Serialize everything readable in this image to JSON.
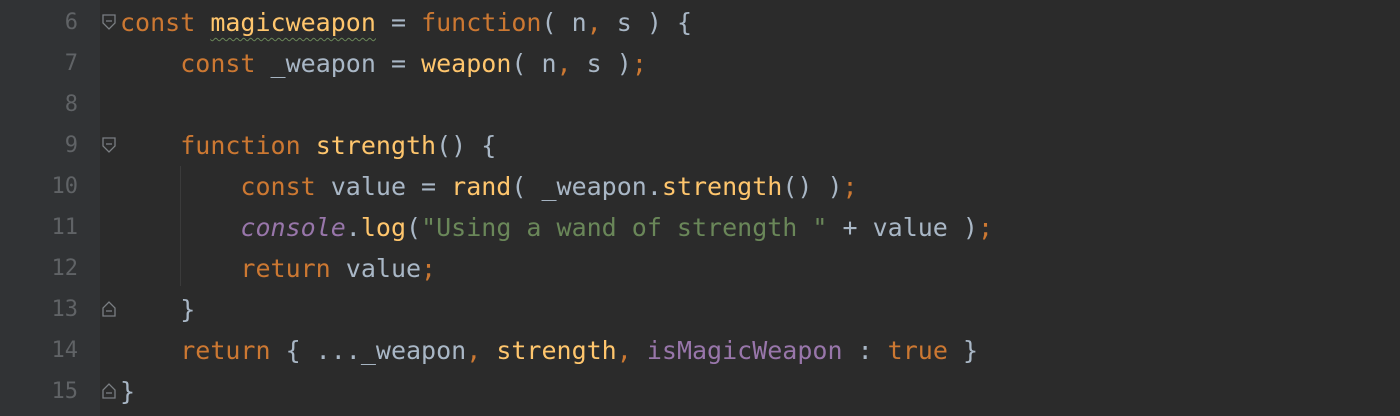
{
  "gutter": {
    "line_numbers": [
      "6",
      "7",
      "8",
      "9",
      "10",
      "11",
      "12",
      "13",
      "14",
      "15"
    ]
  },
  "code": {
    "line6": {
      "kw_const": "const",
      "name": "magicweapon",
      "eq": " = ",
      "kw_function": "function",
      "params_open": "( n",
      "comma": ",",
      "params_close": " s ) {"
    },
    "line7": {
      "indent": "    ",
      "kw_const": "const",
      "var": " _weapon = ",
      "call": "weapon",
      "args_open": "( n",
      "comma": ",",
      "args_close": " s )",
      "semi": ";"
    },
    "line8": {},
    "line9": {
      "indent": "    ",
      "kw_function": "function",
      "name": " strength",
      "rest": "() {"
    },
    "line10": {
      "indent": "        ",
      "kw_const": "const",
      "var": " value = ",
      "call": "rand",
      "arg_open": "( _weapon.",
      "method": "strength",
      "arg_close": "() )",
      "semi": ";"
    },
    "line11": {
      "indent": "        ",
      "console": "console",
      "dot": ".",
      "log": "log",
      "paren": "(",
      "string": "\"Using a wand of strength \"",
      "concat": " + value )",
      "semi": ";"
    },
    "line12": {
      "indent": "        ",
      "kw_return": "return",
      "value": " value",
      "semi": ";"
    },
    "line13": {
      "indent": "    ",
      "brace": "}"
    },
    "line14": {
      "indent": "    ",
      "kw_return": "return",
      "open": " { ..._weapon",
      "comma1": ",",
      "strength": " strength",
      "comma2": ",",
      "prop": " isMagicWeapon",
      "colon": " : ",
      "kw_true": "true",
      "close": " }"
    },
    "line15": {
      "brace": "}"
    }
  },
  "colors": {
    "background": "#2b2b2b",
    "gutter": "#313335",
    "keyword": "#cc7832",
    "function": "#ffc66d",
    "identifier": "#a9b7c6",
    "string": "#6a8759",
    "property": "#9876aa",
    "line_number": "#606366"
  },
  "icons": [
    "fold-open-icon",
    "fold-close-icon"
  ]
}
